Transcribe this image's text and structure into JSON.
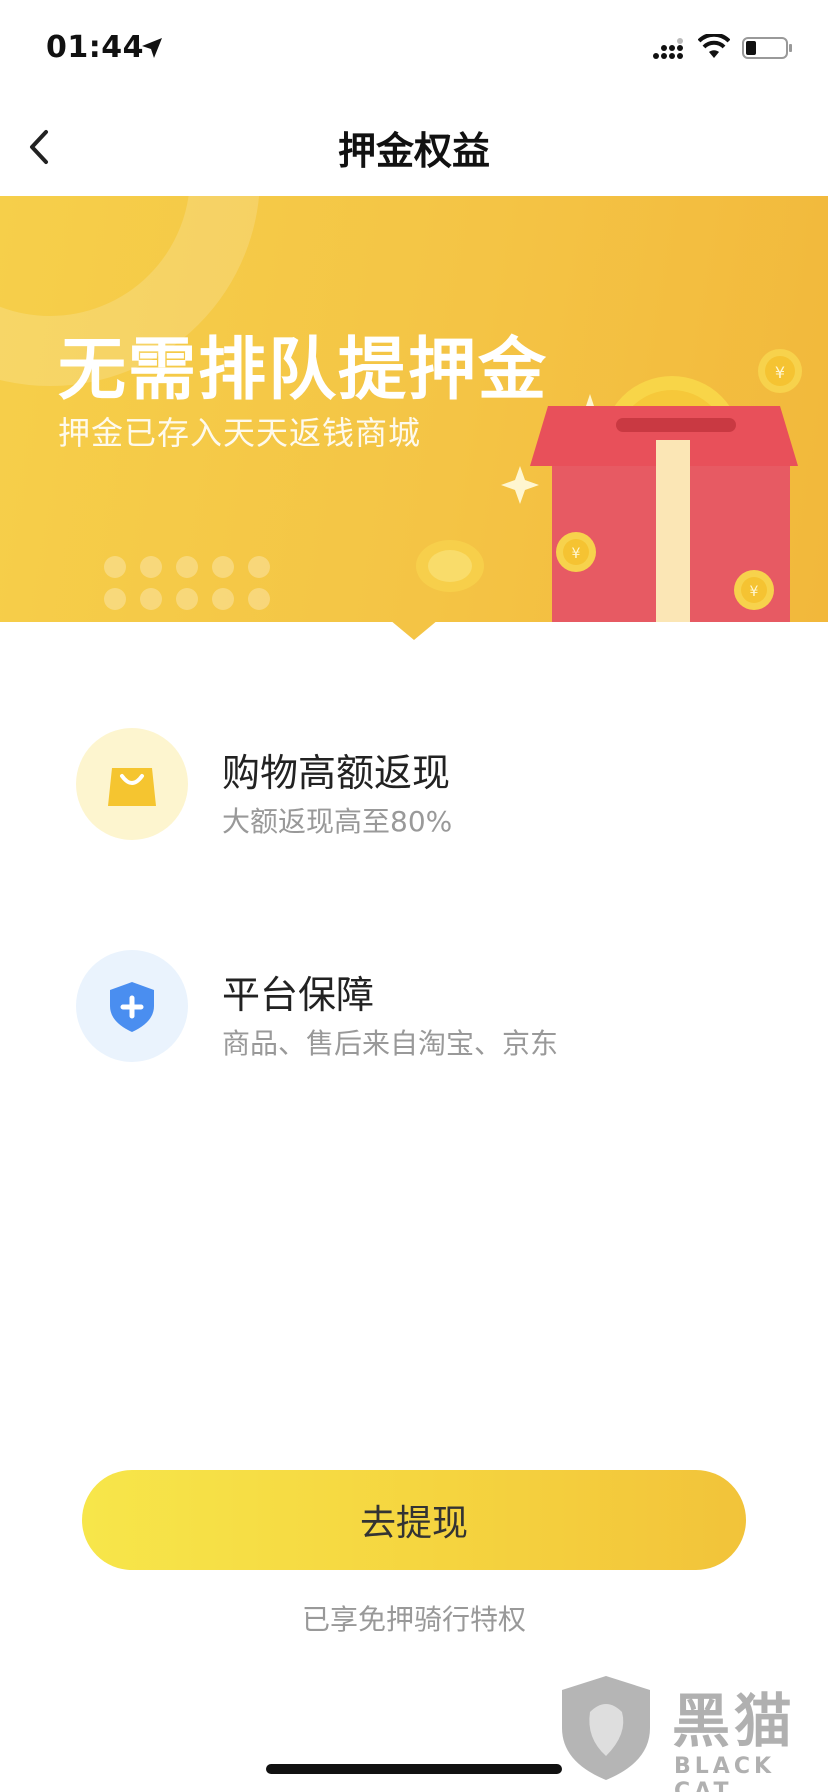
{
  "status_bar": {
    "time": "01:44"
  },
  "nav": {
    "title": "押金权益"
  },
  "banner": {
    "title": "无需排队提押金",
    "subtitle": "押金已存入天天返钱商城"
  },
  "features": [
    {
      "title": "购物高额返现",
      "desc": "大额返现高至80%",
      "icon": "shopping-bag-icon"
    },
    {
      "title": "平台保障",
      "desc": "商品、售后来自淘宝、京东",
      "icon": "shield-plus-icon"
    }
  ],
  "action": {
    "button_label": "去提现",
    "footnote": "已享免押骑行特权"
  },
  "watermark": {
    "text": "黑猫",
    "sub": "BLACK CAT"
  },
  "colors": {
    "banner": "#f4c445",
    "button_start": "#f7e64a",
    "button_end": "#f2c33a",
    "shield_blue": "#4a8ef0",
    "bag_yellow": "#f5c530"
  }
}
